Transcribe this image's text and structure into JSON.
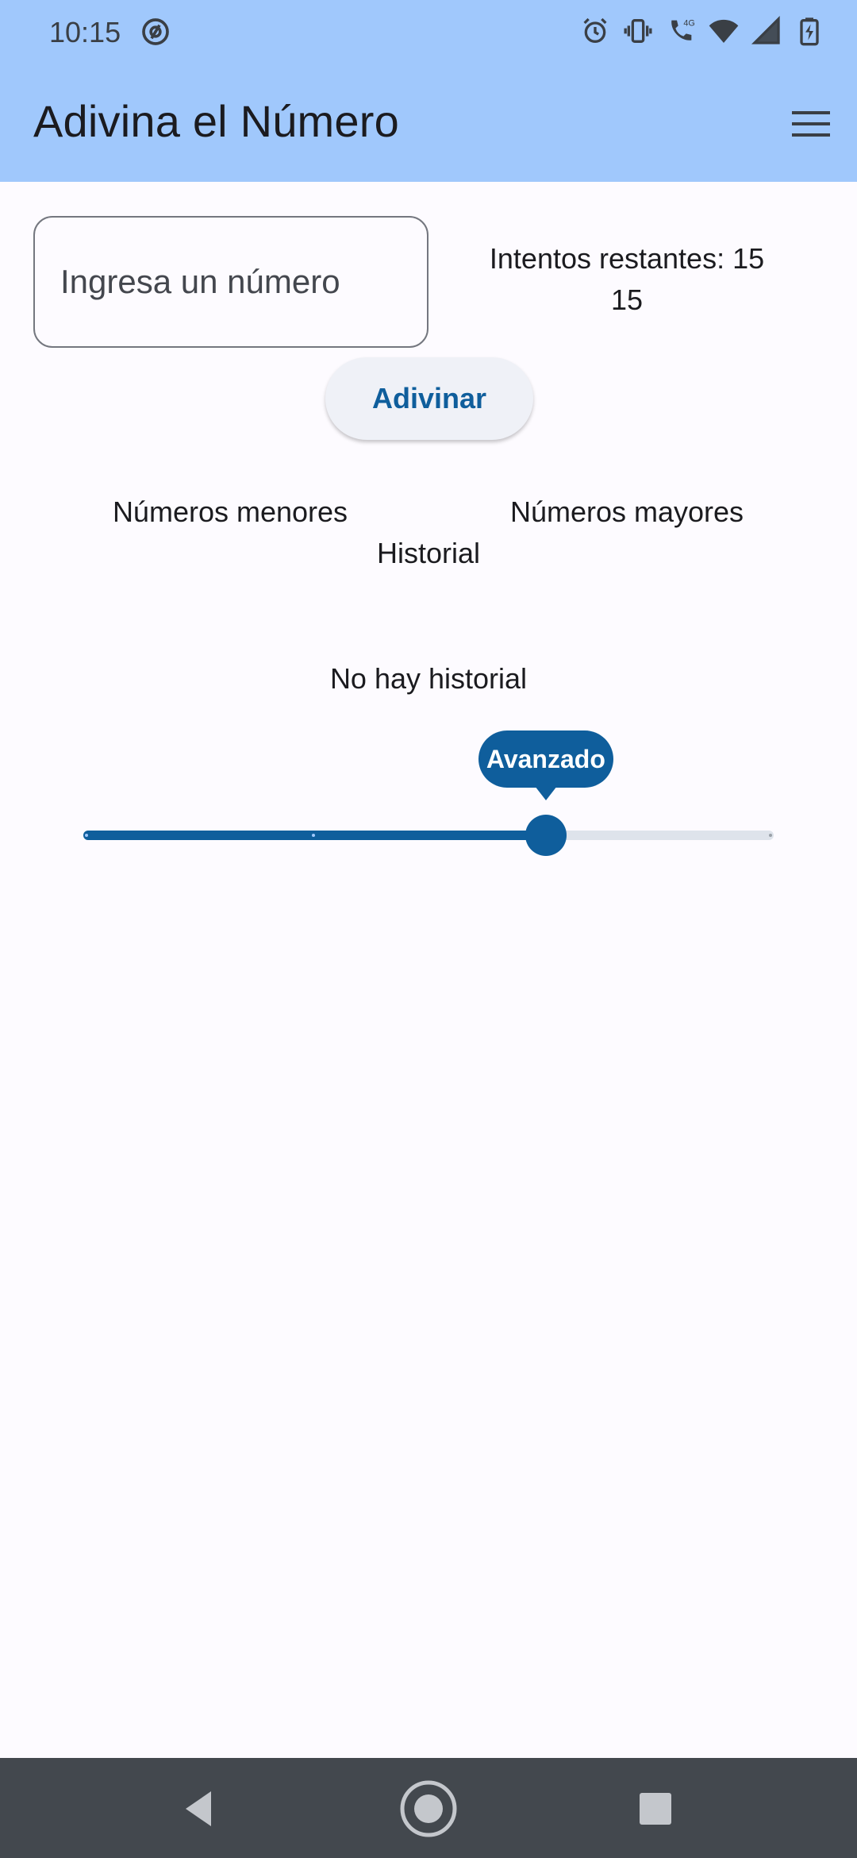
{
  "status_bar": {
    "time": "10:15",
    "icons": [
      "at-sign-icon",
      "alarm-icon",
      "vibrate-icon",
      "wifi-calling-icon",
      "wifi-icon",
      "signal-icon",
      "battery-charging-icon"
    ],
    "network_label": "4G"
  },
  "app_bar": {
    "title": "Adivina el Número",
    "menu_icon": "hamburger-menu-icon"
  },
  "guess_input": {
    "placeholder": "Ingresa un número",
    "value": ""
  },
  "attempts": {
    "label": "Intentos restantes: 15",
    "count": "15"
  },
  "guess_button": {
    "label": "Adivinar"
  },
  "lists": {
    "lower_label": "Números menores",
    "higher_label": "Números mayores"
  },
  "history": {
    "label": "Historial",
    "empty_message": "No hay historial"
  },
  "difficulty_slider": {
    "value_label": "Avanzado",
    "level": 0.67,
    "divisions": 3,
    "active_color": "#0F5E9C",
    "inactive_color": "#DEE3EB"
  },
  "nav_bar": {
    "icons": [
      "back-icon",
      "home-icon",
      "recents-icon"
    ]
  },
  "colors": {
    "app_bar_bg": "#A0C8FC",
    "primary": "#0F5E9C",
    "background": "#FDFBFF",
    "nav_bar_bg": "#43484E"
  }
}
